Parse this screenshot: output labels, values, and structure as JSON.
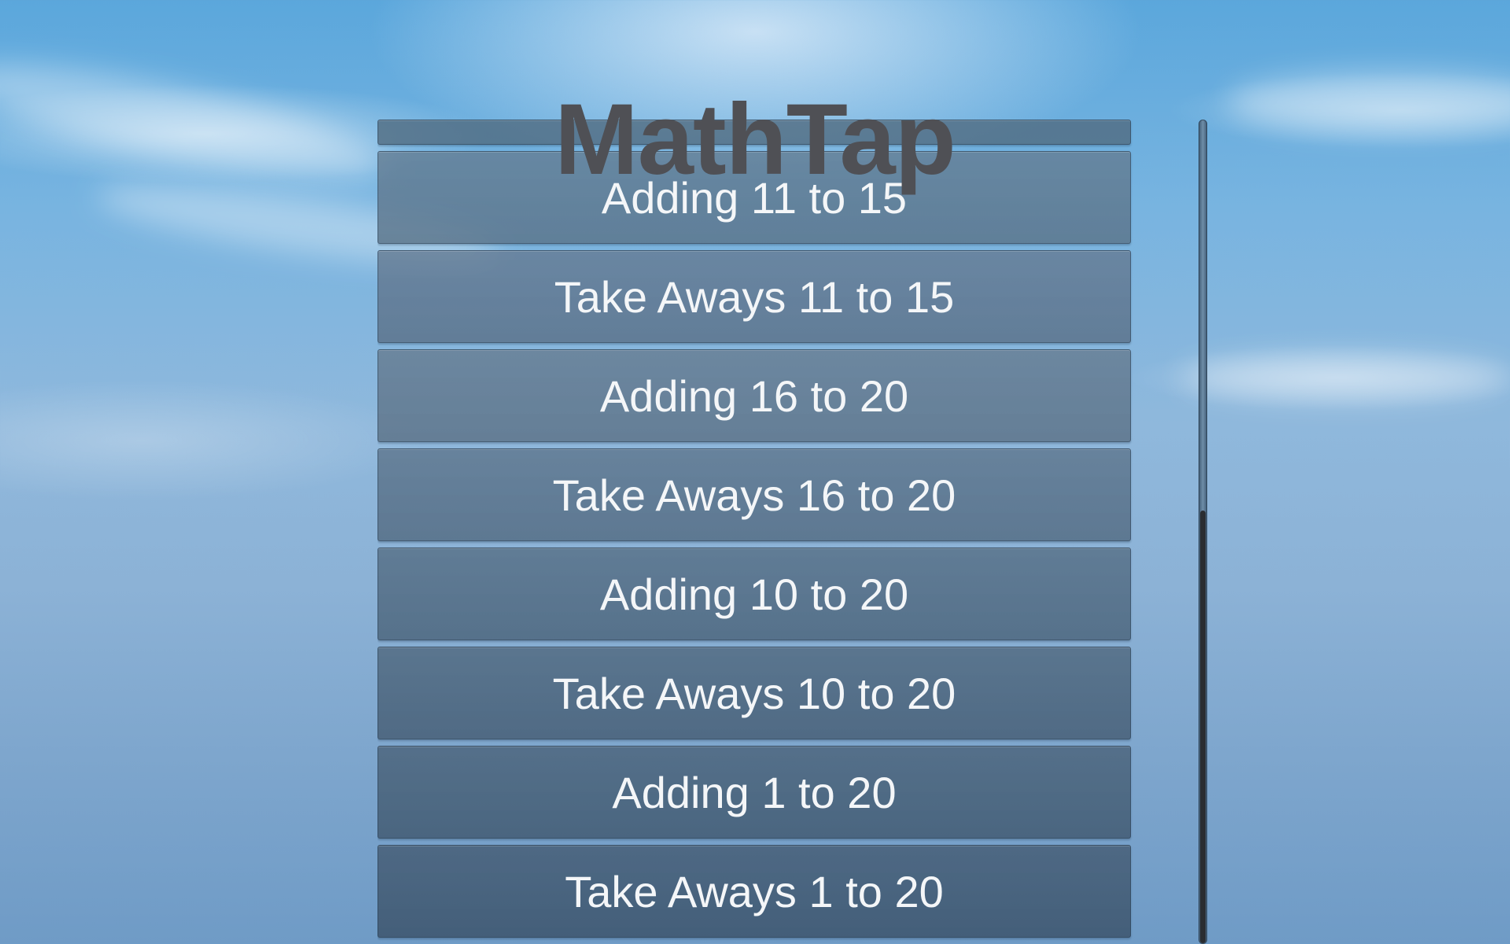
{
  "app": {
    "title": "MathTap"
  },
  "menu": {
    "items": [
      {
        "label": "Adding 11 to 15",
        "color": "#5a7389"
      },
      {
        "label": "Take Aways 11 to 15",
        "color": "#5a7088"
      },
      {
        "label": "Adding 16 to 20",
        "color": "#5b7186"
      },
      {
        "label": "Take Aways 16 to 20",
        "color": "#536b82"
      },
      {
        "label": "Adding 10 to 20",
        "color": "#4b647b"
      },
      {
        "label": "Take Aways 10 to 20",
        "color": "#455d74"
      },
      {
        "label": "Adding 1 to 20",
        "color": "#40586f"
      },
      {
        "label": "Take Aways 1 to 20",
        "color": "#3a5168"
      }
    ]
  },
  "scroll": {
    "position_fraction": 1.0
  }
}
